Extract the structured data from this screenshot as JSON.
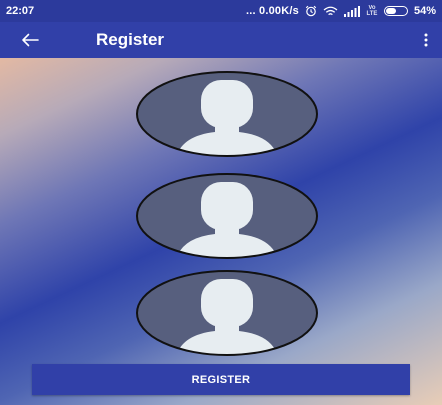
{
  "status_bar": {
    "time": "22:07",
    "net_speed": "... 0.00K/s",
    "network_type": "LTE",
    "volte_label": "Vo",
    "battery_percent_text": "54%",
    "battery_level": 0.54,
    "icons": [
      "alarm-icon",
      "wifi-icon",
      "signal-icon",
      "volte-lte-icon",
      "battery-icon"
    ]
  },
  "app_bar": {
    "title": "Register",
    "back_icon": "arrow-left-icon",
    "menu_icon": "more-vertical-icon",
    "color": "#3140a8"
  },
  "avatars": [
    {
      "icon": "avatar-placeholder-icon"
    },
    {
      "icon": "avatar-placeholder-icon"
    },
    {
      "icon": "avatar-placeholder-icon"
    }
  ],
  "register_button": {
    "label": "REGISTER",
    "color": "#3140a8"
  }
}
